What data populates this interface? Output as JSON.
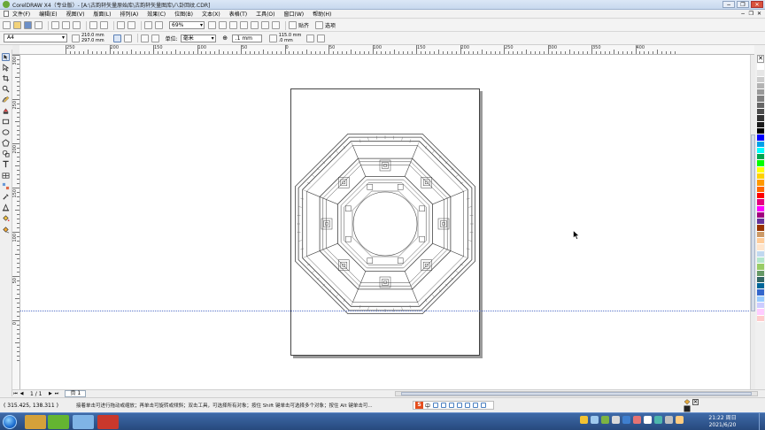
{
  "window": {
    "title": "CorelDRAW X4（专业版）- [A:\\古韵轩矢量原始库\\古韵轩矢量图库\\八卦回纹.CDR]",
    "controls": [
      "−",
      "❐",
      "✕"
    ]
  },
  "menu": {
    "items": [
      "文件(F)",
      "编辑(E)",
      "视图(V)",
      "版面(L)",
      "排列(A)",
      "效果(C)",
      "位图(B)",
      "文本(X)",
      "表格(T)",
      "工具(O)",
      "窗口(W)",
      "帮助(H)"
    ]
  },
  "toolbar": {
    "zoom": "69%",
    "snap_label": "贴齐",
    "options_label": "选项",
    "launcher_label": "应用程序启动器",
    "welcome_label": "欢迎屏幕"
  },
  "propbar": {
    "paper_type": "A4",
    "width": "210.0 mm",
    "height": "297.0 mm",
    "units_label": "单位:",
    "units": "毫米",
    "nudge": ".1 mm",
    "dup_x": "115.0 mm",
    "dup_y": ".0 mm"
  },
  "rulers": {
    "top_labels": [
      "250",
      "200",
      "150",
      "100",
      "50",
      "0",
      "50",
      "100",
      "150",
      "200",
      "250",
      "300",
      "350",
      "400"
    ],
    "left_labels": [
      "300",
      "250",
      "200",
      "150",
      "100",
      "50",
      "0"
    ]
  },
  "palette": {
    "colors": [
      "#ffffff",
      "#e6e6e6",
      "#cccccc",
      "#b3b3b3",
      "#999999",
      "#808080",
      "#666666",
      "#4d4d4d",
      "#333333",
      "#1a1a1a",
      "#000000",
      "#0000ff",
      "#00a0e9",
      "#00ffff",
      "#00a650",
      "#00ff00",
      "#ffff00",
      "#ffd200",
      "#ff9900",
      "#ff6600",
      "#ff0000",
      "#e4007f",
      "#ff00ff",
      "#a0007f",
      "#663399",
      "#993300",
      "#cc9966",
      "#ffcc99",
      "#ffe5cc",
      "#c0d8f0",
      "#b3e6cc",
      "#99cc66",
      "#669966",
      "#336666",
      "#006699",
      "#3366cc",
      "#99ccff",
      "#ccccff",
      "#ffccff",
      "#ffcccc"
    ]
  },
  "bottom": {
    "page_counter": "1 / 1",
    "page_tab": "页 1"
  },
  "status": {
    "coords": "( 315.425, 138.311 )",
    "hint": "接着单击可进行拖动或缩放；再单击可旋转或倾斜；双击工具，可选择所有对象；按住 Shift 键单击可选择多个对象；按住 Alt 键单击可..."
  },
  "ime": {
    "logo": "S",
    "mode": "中"
  },
  "clock": {
    "time": "21:22 周日",
    "date": "2021/6/20"
  },
  "taskbar": {
    "app_colors": [
      "#d4a13a",
      "#64b531",
      "#7fb4e6",
      "#c9382c"
    ]
  }
}
